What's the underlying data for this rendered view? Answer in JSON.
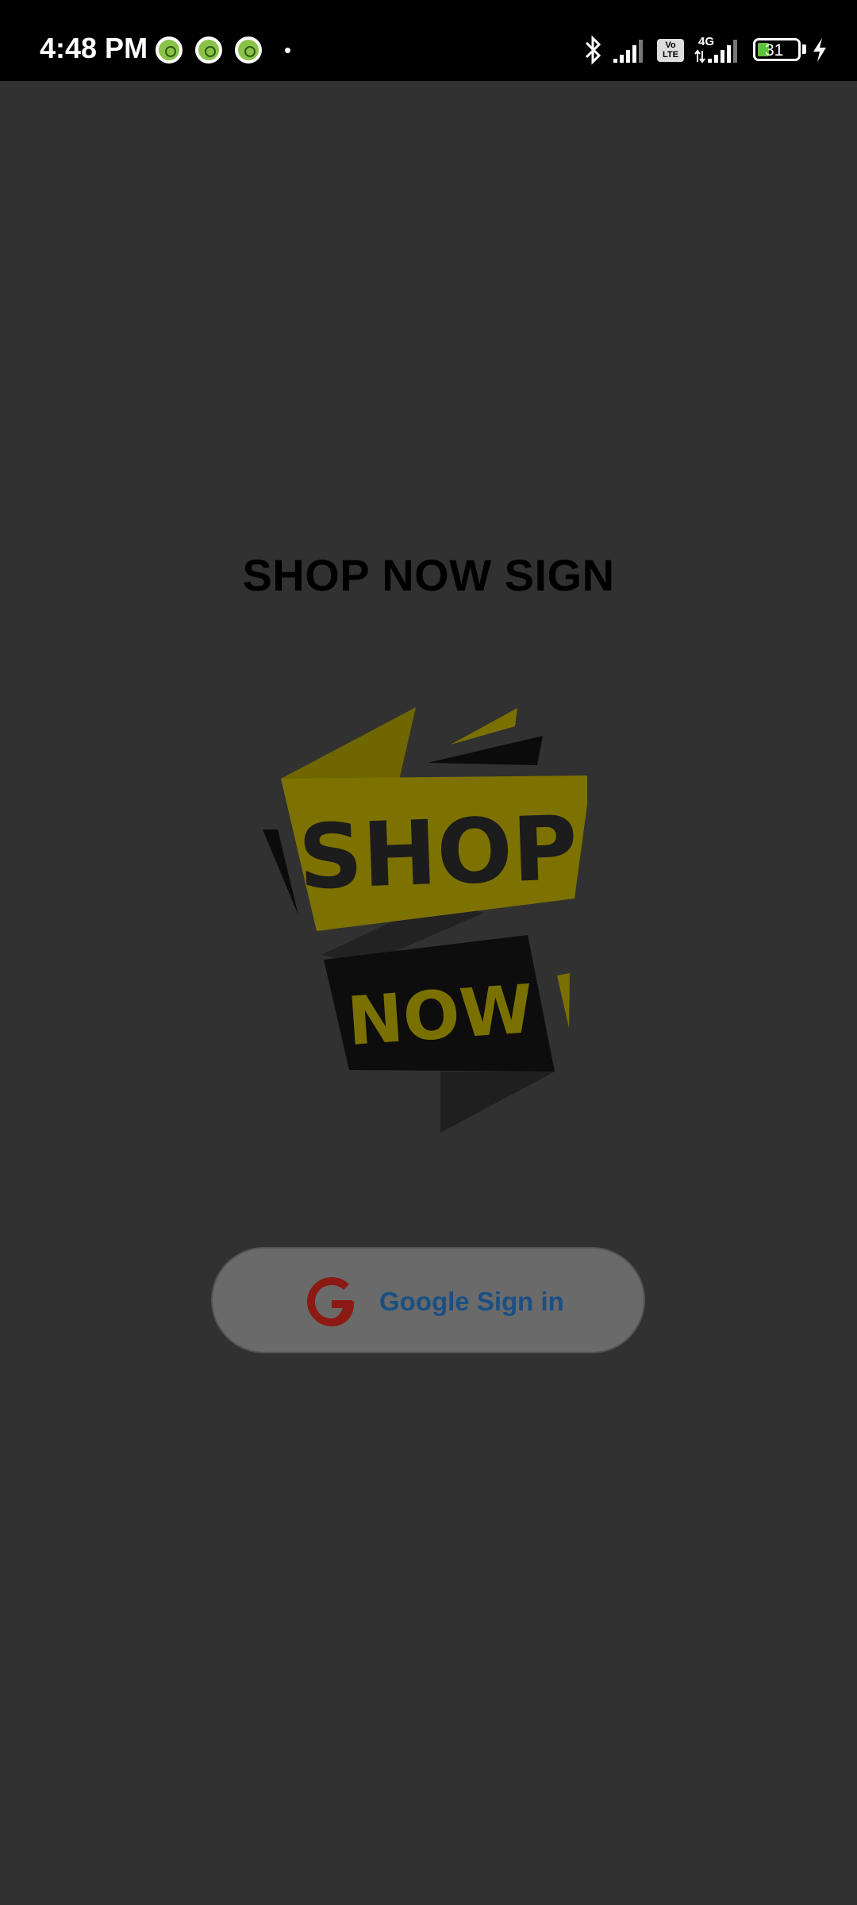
{
  "status_bar": {
    "time": "4:48 PM",
    "network": "4G",
    "volte": "Vo LTE",
    "battery_percent": "31",
    "icons": [
      "notification-icon",
      "notification-icon",
      "notification-icon",
      "bluetooth-icon",
      "signal-icon",
      "volte-icon",
      "signal-4g-icon",
      "battery-icon",
      "charging-icon"
    ]
  },
  "screen": {
    "title": "SHOP NOW SIGN",
    "logo": {
      "line1": "SHOP",
      "line2": "NOW"
    }
  },
  "google_button": {
    "label": "Google Sign in",
    "icon": "google-g-icon"
  },
  "colors": {
    "background": "#313131",
    "logo_yellow": "#7d7200",
    "logo_dark": "#111111",
    "button": "#6a6a6a",
    "button_text": "#1a4f82",
    "google_red": "#8b1a13"
  }
}
